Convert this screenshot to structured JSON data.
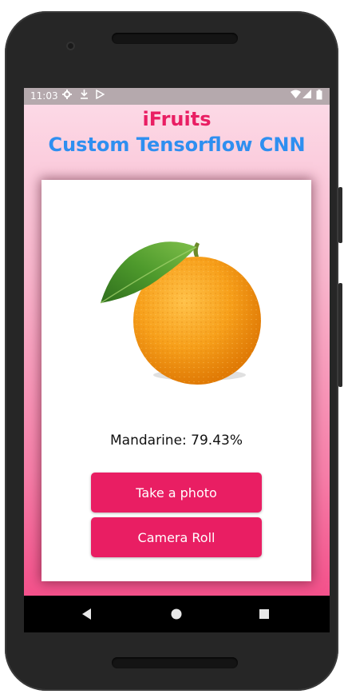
{
  "status": {
    "time": "11:03",
    "icons": [
      "gear-icon",
      "download-icon",
      "play-store-icon",
      "wifi-icon",
      "signal-icon",
      "battery-icon"
    ]
  },
  "app": {
    "title": "iFruits",
    "subtitle": "Custom Tensorflow CNN",
    "result": "Mandarine: 79.43%",
    "buttons": {
      "take_photo": "Take a photo",
      "camera_roll": "Camera Roll"
    },
    "colors": {
      "title": "#e91e63",
      "subtitle": "#2f8ff0",
      "button": "#e91e63"
    }
  },
  "navbar": {
    "icons": [
      "back-icon",
      "home-icon",
      "recents-icon"
    ]
  }
}
